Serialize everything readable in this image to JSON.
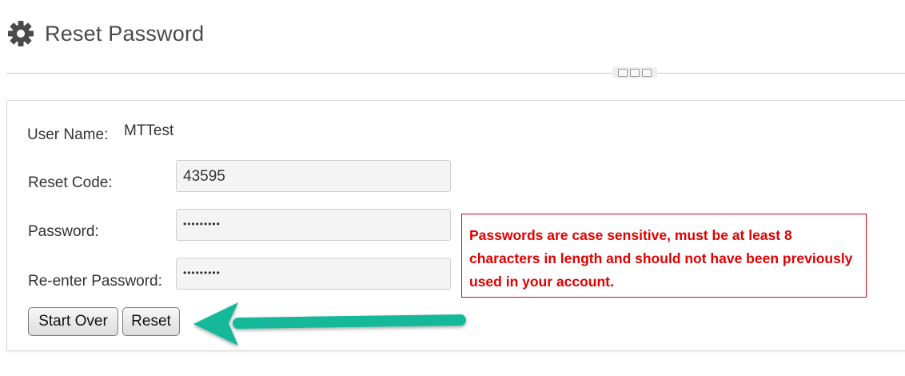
{
  "header": {
    "title": "Reset Password",
    "icon": "gear-icon"
  },
  "form": {
    "username_label": "User Name:",
    "username_value": "MTTest",
    "reset_code_label": "Reset Code:",
    "reset_code_value": "43595",
    "password_label": "Password:",
    "password_mask": "•••••••••",
    "reenter_label": "Re-enter Password:",
    "reenter_mask": "•••••••••"
  },
  "buttons": {
    "start_over": "Start Over",
    "reset": "Reset"
  },
  "notice": {
    "text": "Passwords are case sensitive, must be at least 8 characters in length and should not have been previously used in your account."
  },
  "colors": {
    "notice_text": "#e00000",
    "notice_border": "#d0021b",
    "arrow": "#15b89a",
    "icon": "#4a4a4a"
  }
}
